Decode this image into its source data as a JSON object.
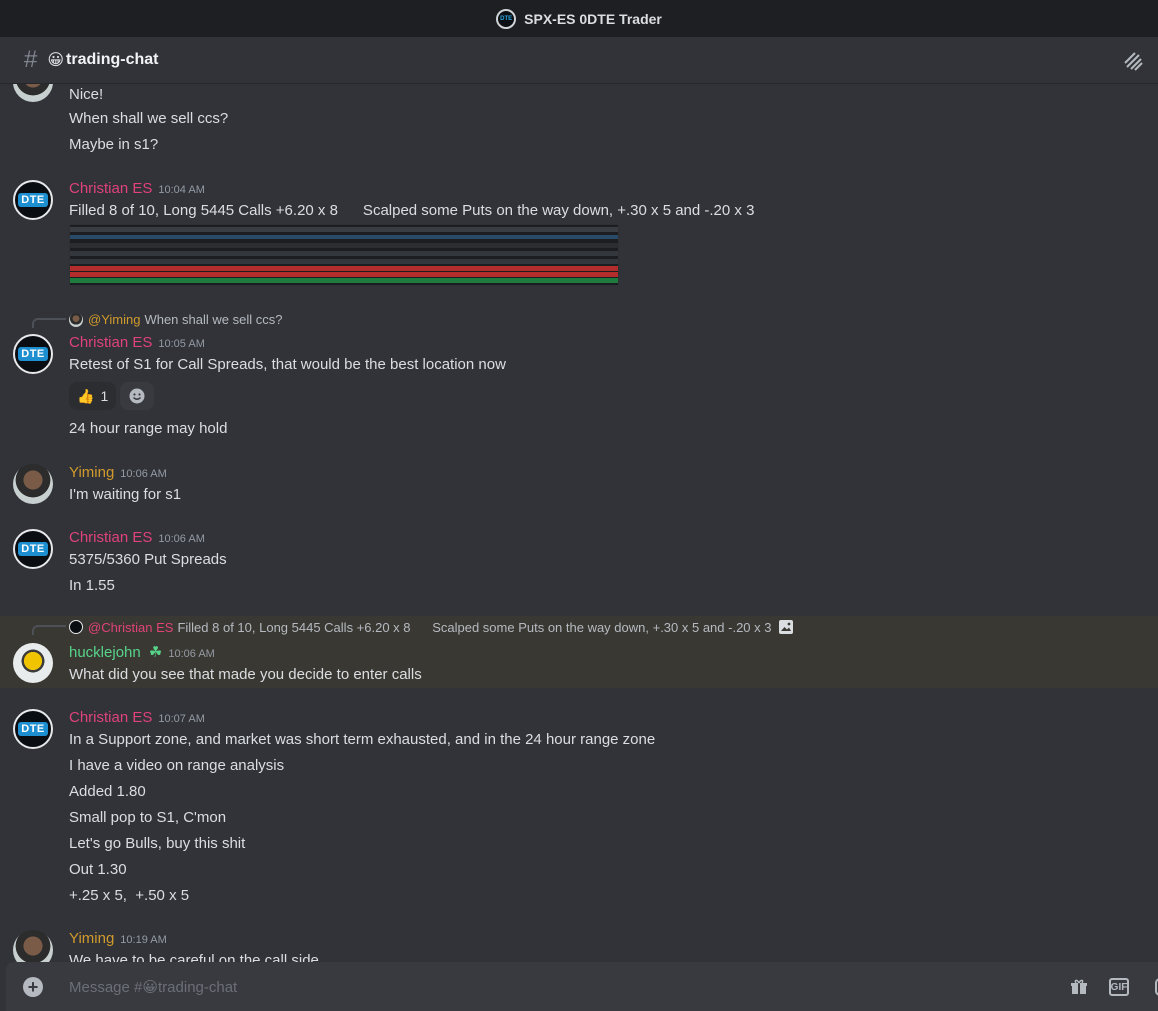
{
  "window": {
    "title": "SPX-ES 0DTE Trader",
    "server_icon_text": "DTE"
  },
  "channel": {
    "hash": "#",
    "emoji": "😀",
    "name": "trading-chat"
  },
  "messages": [
    {
      "lines": [
        "Nice!",
        "When shall we sell ccs?",
        "Maybe in s1?"
      ]
    },
    {
      "author": "Christian ES",
      "time": "10:04 AM",
      "lines": [
        "Filled 8 of 10, Long 5445 Calls +6.20 x 8      Scalped some Puts on the way down, +.30 x 5 and -.20 x 3"
      ]
    },
    {
      "reply_to": {
        "mention": "@Yiming",
        "text": "When shall we sell ccs?"
      },
      "author": "Christian ES",
      "time": "10:05 AM",
      "lines": [
        "Retest of S1 for Call Spreads, that would be the best location now",
        "24 hour range may hold"
      ],
      "reaction": {
        "emoji": "👍",
        "count": "1"
      }
    },
    {
      "author": "Yiming",
      "time": "10:06 AM",
      "lines": [
        "I'm waiting for s1"
      ]
    },
    {
      "author": "Christian ES",
      "time": "10:06 AM",
      "lines": [
        "5375/5360 Put Spreads",
        "In 1.55"
      ]
    },
    {
      "reply_to": {
        "mention": "@Christian ES",
        "text": "Filled 8 of 10, Long 5445 Calls +6.20 x 8      Scalped some Puts on the way down, +.30 x 5 and -.20 x 3"
      },
      "author": "hucklejohn",
      "badge": "☘",
      "time": "10:06 AM",
      "lines": [
        "What did you see that made you decide to enter calls"
      ]
    },
    {
      "author": "Christian ES",
      "time": "10:07 AM",
      "lines": [
        "In a Support zone, and market was short term exhausted, and in the 24 hour range zone",
        "I have a video on range analysis",
        "Added 1.80",
        "Small pop to S1, C'mon",
        "Let's go Bulls, buy this shit",
        "Out 1.30",
        "+.25 x 5,  +.50 x 5"
      ]
    },
    {
      "author": "Yiming",
      "time": "10:19 AM",
      "lines": [
        "We have to be careful on the call side"
      ]
    }
  ],
  "composer": {
    "placeholder_prefix": "Message #",
    "emoji": "😀",
    "placeholder_channel": "trading-chat",
    "gif_label": "GIF"
  },
  "colors": {
    "christian": "#e0427a",
    "yiming": "#d09a2c",
    "hucklejohn": "#57d48a"
  }
}
